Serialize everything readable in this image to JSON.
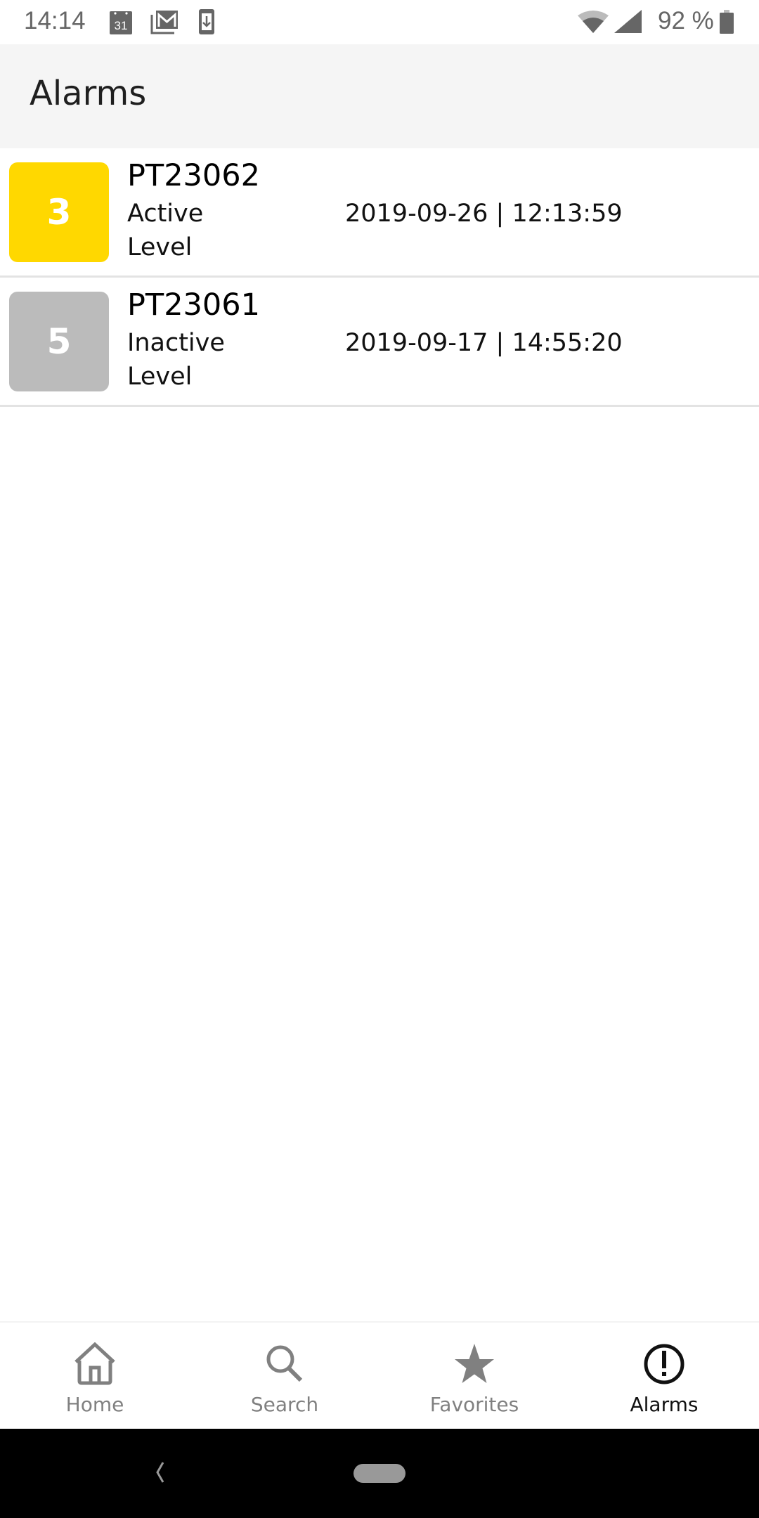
{
  "status_bar": {
    "time": "14:14",
    "calendar_day": "31",
    "notification_icons": [
      "calendar-icon",
      "gmail-icon",
      "download-icon"
    ],
    "system_icons": [
      "wifi-icon",
      "cell-signal-icon",
      "battery-icon"
    ],
    "battery_percent": "92 %"
  },
  "app_bar": {
    "title": "Alarms"
  },
  "alarms": [
    {
      "severity": "3",
      "tag": "PT23062",
      "state": "Active",
      "type": "Level",
      "timestamp": "2019-09-26 | 12:13:59",
      "badge_color": "#FFD800"
    },
    {
      "severity": "5",
      "tag": "PT23061",
      "state": "Inactive",
      "type": "Level",
      "timestamp": "2019-09-17 | 14:55:20",
      "badge_color": "#BBBBBB"
    }
  ],
  "bottom_nav": {
    "items": [
      {
        "label": "Home",
        "icon": "home-icon",
        "active": false
      },
      {
        "label": "Search",
        "icon": "search-icon",
        "active": false
      },
      {
        "label": "Favorites",
        "icon": "star-icon",
        "active": false
      },
      {
        "label": "Alarms",
        "icon": "alert-circle-icon",
        "active": true
      }
    ],
    "inactive_color": "#808080",
    "active_color": "#111111"
  },
  "system_nav": {
    "buttons": [
      "back-icon",
      "home-pill-icon"
    ]
  }
}
